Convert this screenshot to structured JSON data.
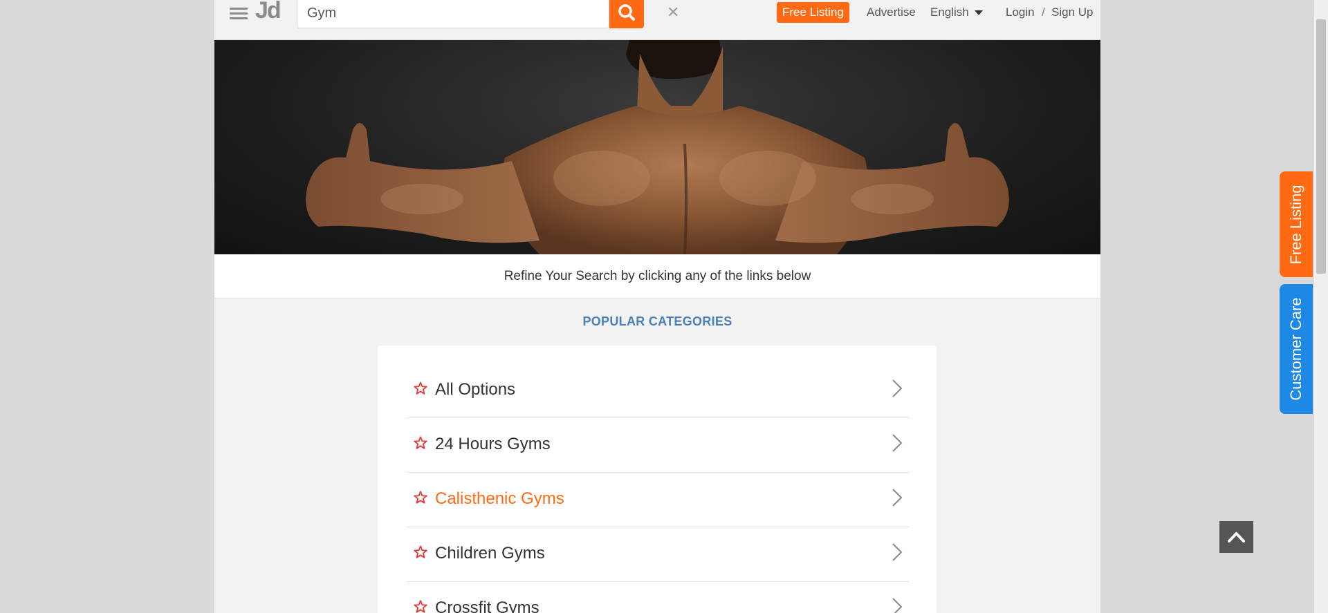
{
  "header": {
    "logo": "Jd",
    "search": {
      "value": "Gym",
      "placeholder": ""
    },
    "free_listing": "Free Listing",
    "advertise": "Advertise",
    "language": "English",
    "login": "Login",
    "separator": "/",
    "signup": "Sign Up"
  },
  "refine_text": "Refine Your Search by clicking any of the links below",
  "popular": {
    "title": "POPULAR CATEGORIES",
    "items": [
      {
        "label": "All Options",
        "active": false
      },
      {
        "label": "24 Hours Gyms",
        "active": false
      },
      {
        "label": "Calisthenic Gyms",
        "active": true
      },
      {
        "label": "Children Gyms",
        "active": false
      },
      {
        "label": "Crossfit Gyms",
        "active": false
      }
    ]
  },
  "side_tabs": {
    "free_listing": "Free Listing",
    "customer_care": "Customer Care"
  },
  "colors": {
    "accent": "#ff6a13",
    "link_blue": "#4a7fb5",
    "customer_care": "#1e88e5",
    "star": "#e53935"
  },
  "icons": [
    "menu-icon",
    "clear-icon",
    "search-icon",
    "caret-down-icon",
    "star-icon",
    "chevron-right-icon",
    "chevron-up-icon"
  ]
}
